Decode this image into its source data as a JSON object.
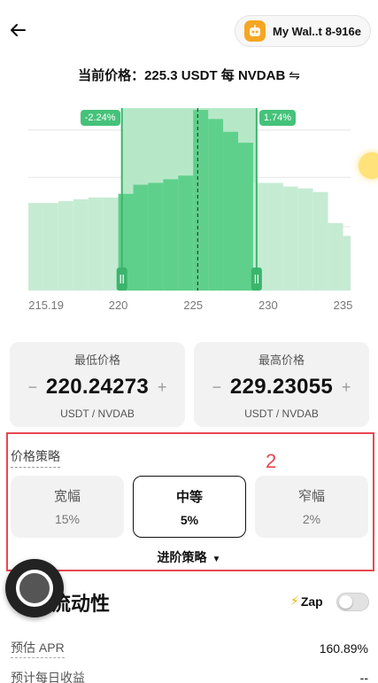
{
  "header": {
    "wallet_label": "My Wal..t 8-916e",
    "back_icon": "arrow-left-icon",
    "wallet_icon": "robot-avatar-icon"
  },
  "price_line": {
    "text": "当前价格：225.3 USDT 每 NVDAB",
    "swap_glyph": "⇋"
  },
  "chart_data": {
    "type": "bar",
    "x_ticks": [
      "215.19",
      "220",
      "225",
      "230",
      "235"
    ],
    "xlim": [
      214,
      235.5
    ],
    "bin_width": 1,
    "bins": [
      214,
      215,
      216,
      217,
      218,
      219,
      220,
      221,
      222,
      223,
      224,
      225,
      226,
      227,
      228,
      229,
      230,
      231,
      232,
      233,
      234,
      235
    ],
    "values": [
      0.48,
      0.48,
      0.49,
      0.5,
      0.51,
      0.51,
      0.53,
      0.58,
      0.59,
      0.61,
      0.63,
      0.99,
      0.94,
      0.87,
      0.81,
      0.59,
      0.59,
      0.57,
      0.56,
      0.54,
      0.37,
      0.3
    ],
    "current_price": 225.3,
    "range_low": 220.24273,
    "range_high": 229.23055,
    "low_badge": "-2.24%",
    "high_badge": "1.74%",
    "colors": {
      "outside": "#c6ebd3",
      "inside": "#5fd08b",
      "range_band": "#b6e8c8",
      "handle": "#3bb56c",
      "grid": "#e5e5e5"
    }
  },
  "min_card": {
    "title": "最低价格",
    "value": "220.24273",
    "unit": "USDT / NVDAB",
    "minus": "−",
    "plus": "+"
  },
  "max_card": {
    "title": "最高价格",
    "value": "229.23055",
    "unit": "USDT / NVDAB",
    "minus": "−",
    "plus": "+"
  },
  "strategy": {
    "title": "价格策略",
    "annotation": "2",
    "options": [
      {
        "name": "宽幅",
        "pct": "15%"
      },
      {
        "name": "中等",
        "pct": "5%"
      },
      {
        "name": "窄幅",
        "pct": "2%"
      }
    ],
    "selected": "中等",
    "advanced_label": "进阶策略",
    "advanced_caret": "▼"
  },
  "liquidity": {
    "title": "流动性",
    "zap_label": "Zap",
    "zap_icon": "lightning-icon",
    "zap_on": false
  },
  "stats": [
    {
      "label": "预估 APR",
      "value": "160.89%"
    },
    {
      "label": "预计每日收益",
      "value": "--"
    }
  ]
}
